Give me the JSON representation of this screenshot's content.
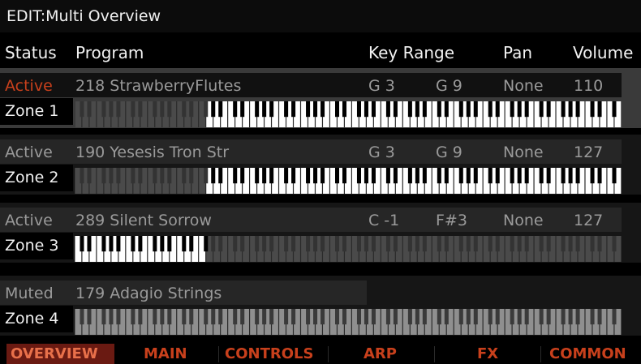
{
  "title": "EDIT:Multi Overview",
  "columns": {
    "status": "Status",
    "program": "Program",
    "key_range": "Key Range",
    "pan": "Pan",
    "volume": "Volume"
  },
  "zones": [
    {
      "status": "Active",
      "program": "218 StrawberryFlutes",
      "key_low": "G 3",
      "key_high": "G 9",
      "pan": "None",
      "volume": "110",
      "label": "Zone 1",
      "range_start_key": 31,
      "range_end_key": 127
    },
    {
      "status": "Active",
      "program": "190 Yesesis Tron Str",
      "key_low": "G 3",
      "key_high": "G 9",
      "pan": "None",
      "volume": "127",
      "label": "Zone 2",
      "range_start_key": 31,
      "range_end_key": 127
    },
    {
      "status": "Active",
      "program": "289 Silent Sorrow",
      "key_low": "C -1",
      "key_high": "F#3",
      "pan": "None",
      "volume": "127",
      "label": "Zone 3",
      "range_start_key": 0,
      "range_end_key": 30
    },
    {
      "status": "Muted",
      "program": "179 Adagio Strings",
      "label": "Zone 4"
    }
  ],
  "tabs": [
    "OVERVIEW",
    "MAIN",
    "CONTROLS",
    "ARP",
    "FX",
    "COMMON"
  ],
  "selected_tab": "OVERVIEW",
  "colors": {
    "accent": "#c8401c",
    "selected_tab_bg": "#6a1a12",
    "key_white": "#ffffff",
    "key_black": "#000000",
    "key_dim": "#4a4a4a"
  }
}
